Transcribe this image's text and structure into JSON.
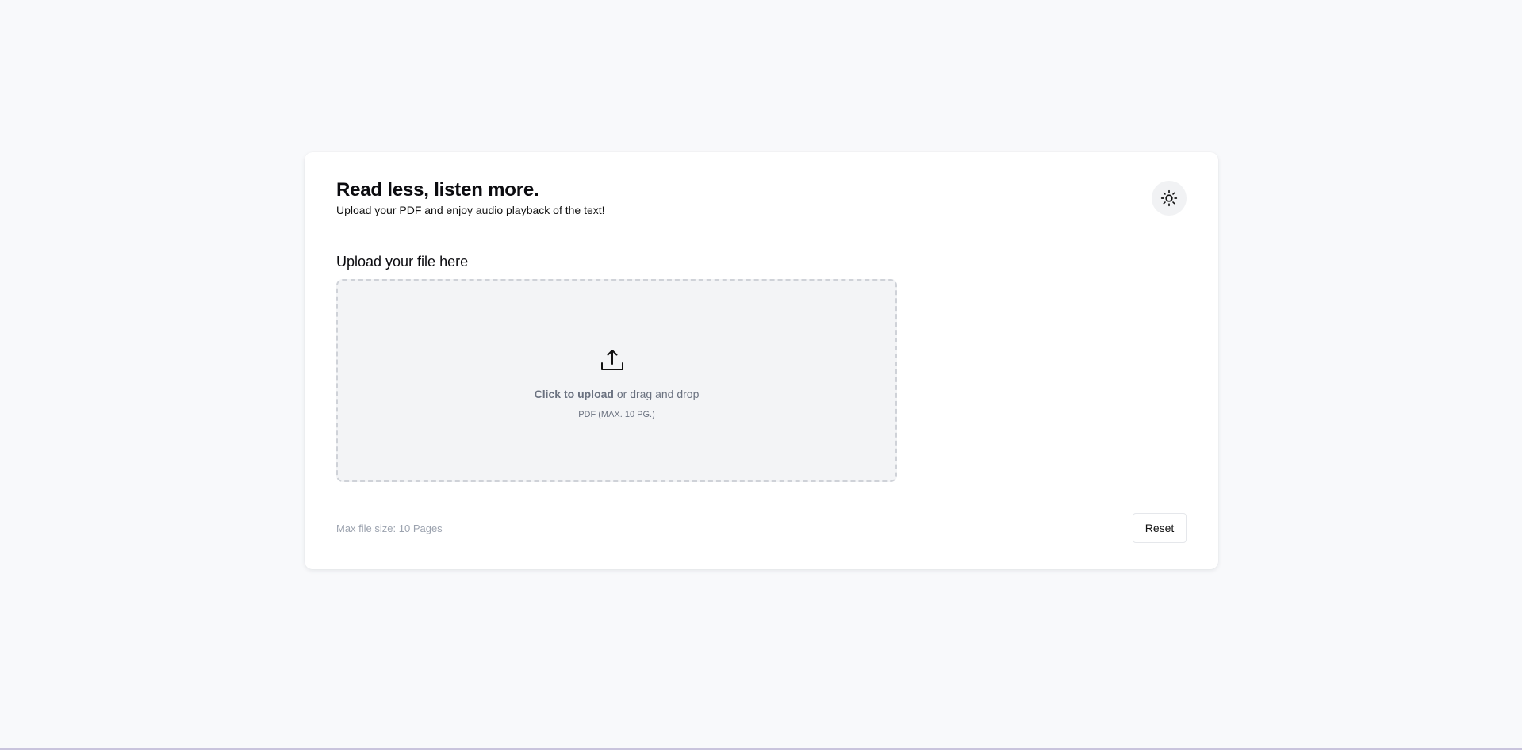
{
  "header": {
    "title": "Read less, listen more.",
    "subtitle": "Upload your PDF and enjoy audio playback of the text!",
    "theme_toggle_icon": "sun-icon"
  },
  "upload": {
    "section_label": "Upload your file here",
    "icon": "upload-icon",
    "click_label": "Click to upload",
    "drag_label": " or drag and drop",
    "hint": "PDF (MAX. 10 PG.)"
  },
  "footer": {
    "note": "Max file size: 10 Pages",
    "reset_label": "Reset"
  },
  "colors": {
    "background": "#f8f9fb",
    "card": "#ffffff",
    "dropzone": "#f3f4f6",
    "muted_text": "#6b7280"
  }
}
